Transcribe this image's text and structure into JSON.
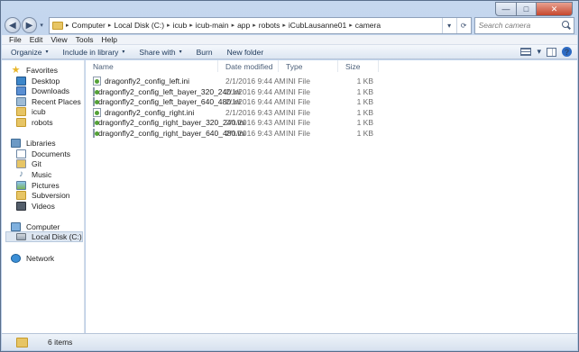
{
  "window": {
    "controls": {
      "minimize": "—",
      "maximize": "□",
      "close": "✕"
    }
  },
  "nav": {
    "back": "◀",
    "forward": "▶",
    "recent": "▾",
    "breadcrumb": [
      "Computer",
      "Local Disk (C:)",
      "icub",
      "icub-main",
      "app",
      "robots",
      "iCubLausanne01",
      "camera"
    ],
    "separator": "▸",
    "dropdown": "▾",
    "refresh": "⟳",
    "search_placeholder": "Search camera"
  },
  "menu": [
    "File",
    "Edit",
    "View",
    "Tools",
    "Help"
  ],
  "toolbar": {
    "organize": "Organize",
    "include": "Include in library",
    "share": "Share with",
    "burn": "Burn",
    "new_folder": "New folder",
    "arrow": "▾",
    "view_arrow": "▾",
    "help": "?"
  },
  "sidebar": {
    "favorites": "Favorites",
    "desktop": "Desktop",
    "downloads": "Downloads",
    "recent": "Recent Places",
    "icub": "icub",
    "robots": "robots",
    "libraries": "Libraries",
    "documents": "Documents",
    "git": "Git",
    "music": "Music",
    "pictures": "Pictures",
    "subversion": "Subversion",
    "videos": "Videos",
    "computer": "Computer",
    "localdisk": "Local Disk (C:)",
    "network": "Network",
    "star": "★",
    "note": "♪"
  },
  "columns": {
    "name": "Name",
    "date": "Date modified",
    "type": "Type",
    "size": "Size"
  },
  "files": [
    {
      "name": "dragonfly2_config_left.ini",
      "date": "2/1/2016 9:44 AM",
      "type": "INI File",
      "size": "1 KB"
    },
    {
      "name": "dragonfly2_config_left_bayer_320_240.ini",
      "date": "2/1/2016 9:44 AM",
      "type": "INI File",
      "size": "1 KB"
    },
    {
      "name": "dragonfly2_config_left_bayer_640_480.ini",
      "date": "2/1/2016 9:44 AM",
      "type": "INI File",
      "size": "1 KB"
    },
    {
      "name": "dragonfly2_config_right.ini",
      "date": "2/1/2016 9:43 AM",
      "type": "INI File",
      "size": "1 KB"
    },
    {
      "name": "dragonfly2_config_right_bayer_320_240.ini",
      "date": "2/1/2016 9:43 AM",
      "type": "INI File",
      "size": "1 KB"
    },
    {
      "name": "dragonfly2_config_right_bayer_640_480.ini",
      "date": "2/1/2016 9:43 AM",
      "type": "INI File",
      "size": "1 KB"
    }
  ],
  "status": {
    "count": "6 items"
  }
}
